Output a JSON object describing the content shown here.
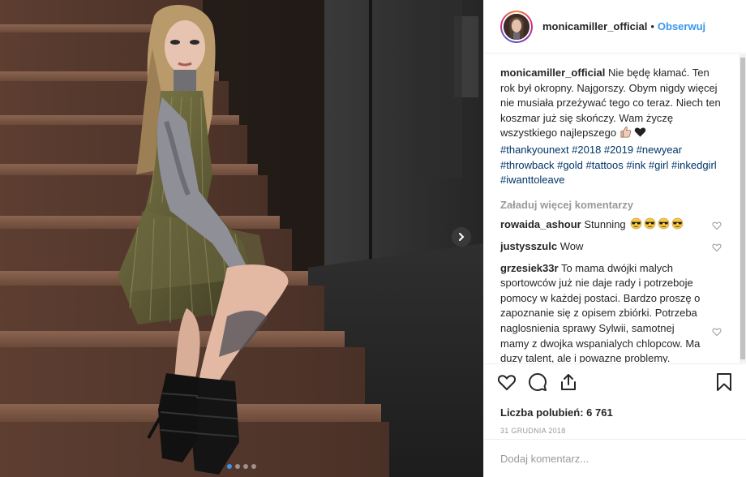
{
  "header": {
    "username": "monicamiller_official",
    "separator": "•",
    "follow_label": "Obserwuj"
  },
  "caption": {
    "username": "monicamiller_official",
    "text": "Nie będę kłamać. Ten rok był okropny. Najgorszy. Obym nigdy więcej nie musiała przeżywać tego co teraz. Niech ten koszmar już się skończy. Wam życzę wszystkiego najlepszego",
    "hashtags": "#thankyounext #2018 #2019 #newyear #throwback #gold #tattoos #ink #girl #inkedgirl #iwanttoleave",
    "emojis": [
      "thumbs-up",
      "black-heart"
    ]
  },
  "load_more_label": "Załaduj więcej komentarzy",
  "comments": [
    {
      "username": "rowaida_ashour",
      "text": "Stunning",
      "emojis": [
        "sunglasses",
        "sunglasses",
        "sunglasses",
        "sunglasses"
      ]
    },
    {
      "username": "justysszulc",
      "text": "Wow",
      "emojis": []
    },
    {
      "username": "grzesiek33r",
      "text": "To mama dwójki malych sportowców już nie daje rady i potrzeboje pomocy w każdej postaci. Bardzo proszę o zapoznanie się z opisem zbiórki. Potrzeba naglosnienia sprawy Sylwii, samotnej mamy z dwojka wspanialych chlopcow. Ma duzy talent, ale i powazne problemy.",
      "emojis": []
    }
  ],
  "actions": {
    "icons": [
      "heart-icon",
      "comment-icon",
      "share-icon",
      "bookmark-icon"
    ]
  },
  "likes_text": "Liczba polubień: 6 761",
  "date_text": "31 GRUDNIA 2018",
  "comment_input": {
    "placeholder": "Dodaj komentarz...",
    "value": ""
  },
  "carousel": {
    "total": 4,
    "active": 1
  },
  "colors": {
    "accent": "#3897f0",
    "hashtag": "#003569",
    "muted": "#999999",
    "border": "#efefef"
  }
}
